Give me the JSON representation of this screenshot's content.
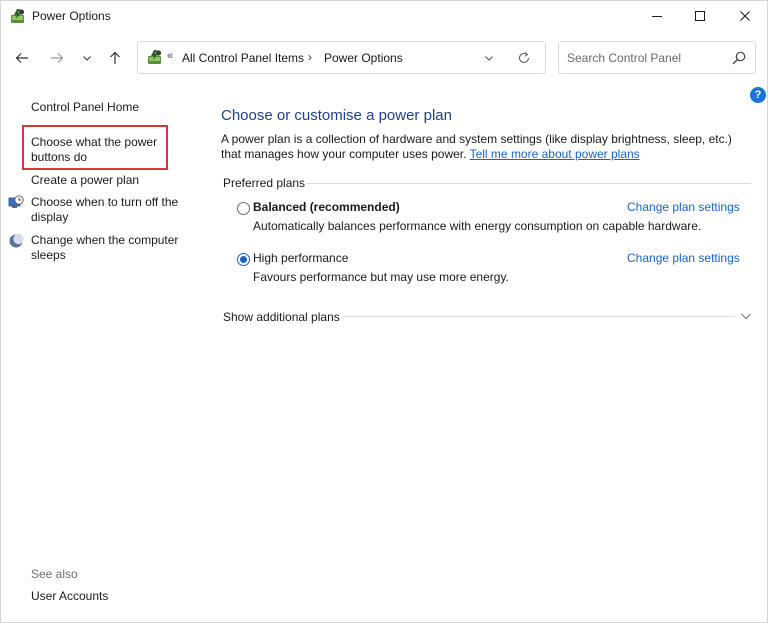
{
  "window": {
    "title": "Power Options"
  },
  "address_bar": {
    "overflow_chevron": "«",
    "crumbs": [
      "All Control Panel Items",
      "Power Options"
    ],
    "separator": "›"
  },
  "search": {
    "placeholder": "Search Control Panel"
  },
  "sidebar": {
    "home": "Control Panel Home",
    "links": [
      {
        "label": "Choose what the power buttons do",
        "icon": "none"
      },
      {
        "label": "Create a power plan",
        "icon": "none"
      },
      {
        "label": "Choose when to turn off the display",
        "icon": "display-timer-icon"
      },
      {
        "label": "Change when the computer sleeps",
        "icon": "moon-sleep-icon"
      }
    ],
    "see_also": "See also",
    "see_also_links": [
      "User Accounts"
    ]
  },
  "main": {
    "title": "Choose or customise a power plan",
    "description": "A power plan is a collection of hardware and system settings (like display brightness, sleep, etc.) that manages how your computer uses power.",
    "description_link": "Tell me more about power plans",
    "preferred_plans_label": "Preferred plans",
    "plans": [
      {
        "name": "Balanced (recommended)",
        "description": "Automatically balances performance with energy consumption on capable hardware.",
        "selected": false,
        "link": "Change plan settings"
      },
      {
        "name": "High performance",
        "description": "Favours performance but may use more energy.",
        "selected": true,
        "link": "Change plan settings"
      }
    ],
    "show_additional": "Show additional plans"
  },
  "colors": {
    "title_blue": "#1f3f8c",
    "link_blue": "#1a63c7",
    "highlight_red": "#d9373a"
  }
}
